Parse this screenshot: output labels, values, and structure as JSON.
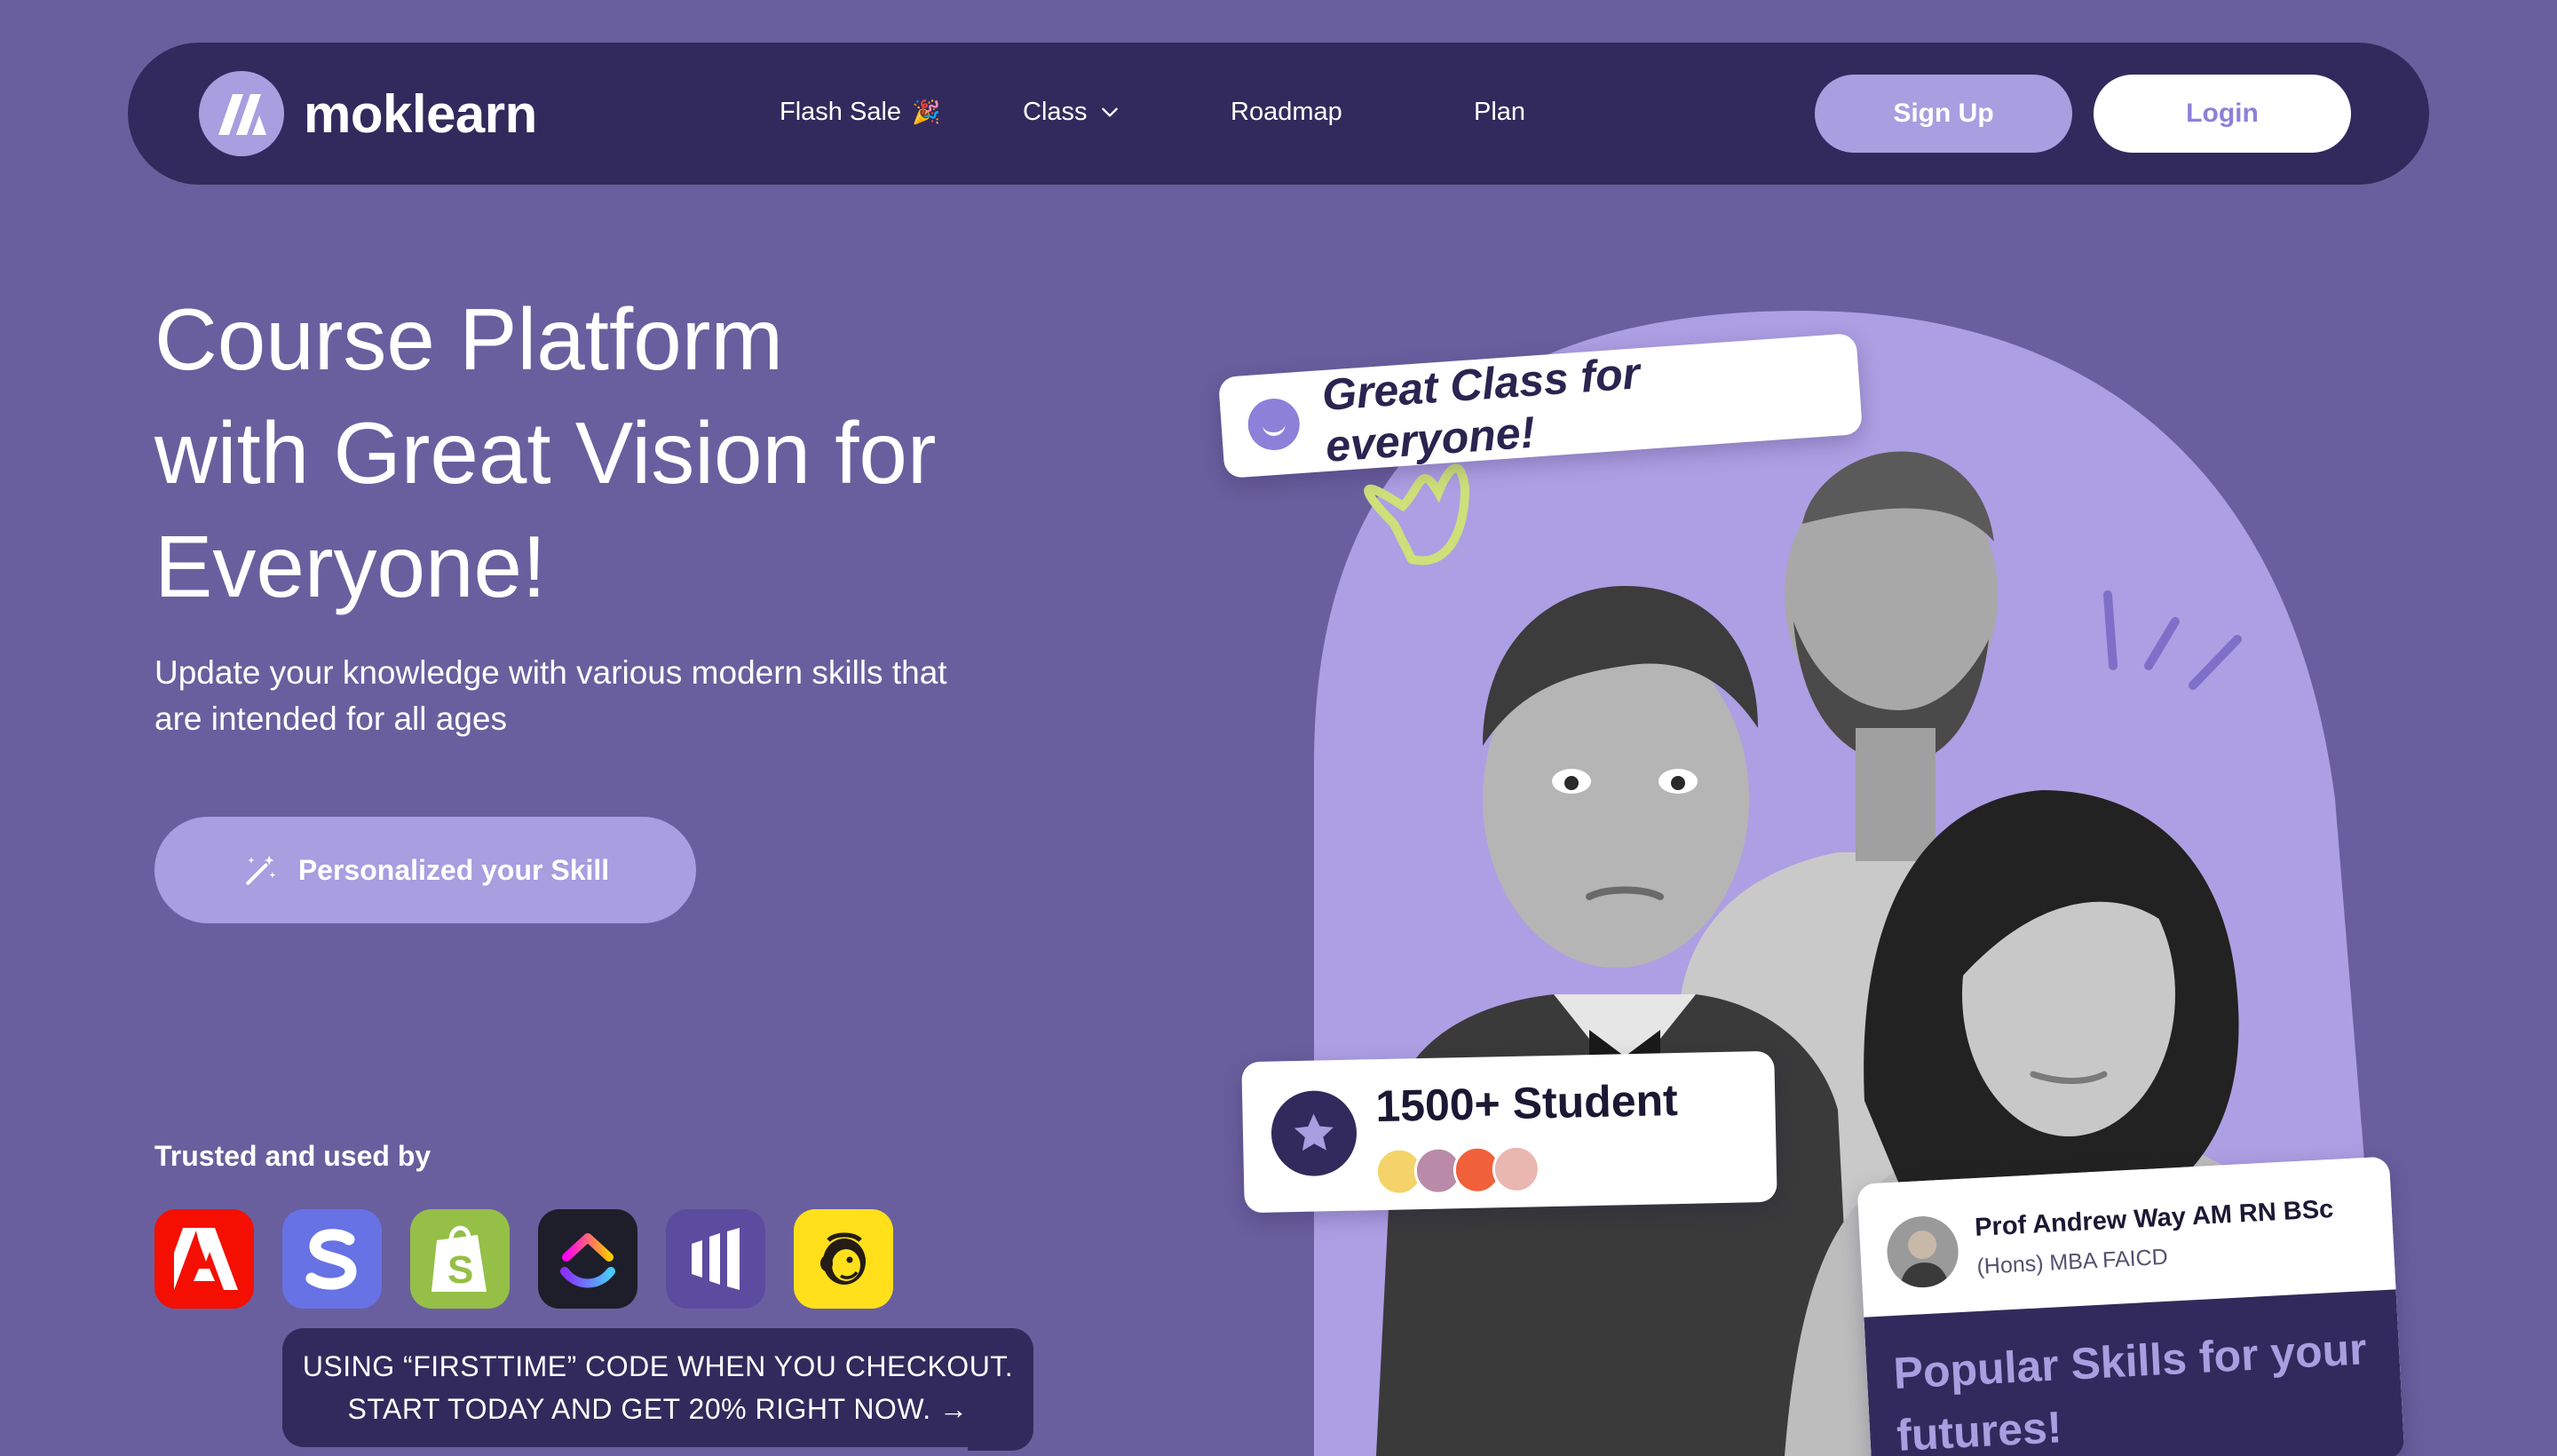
{
  "brand": {
    "name": "moklearn"
  },
  "nav": {
    "links": [
      {
        "label": "Flash Sale",
        "emoji": "🎉"
      },
      {
        "label": "Class"
      },
      {
        "label": "Roadmap"
      },
      {
        "label": "Plan"
      }
    ],
    "signup_label": "Sign Up",
    "login_label": "Login"
  },
  "hero": {
    "title_lines": [
      "Course Platform",
      "with Great Vision for",
      "Everyone!"
    ],
    "subtitle_lines": [
      "Update your knowledge with various modern skills that",
      "are intended for all ages"
    ],
    "cta_label": "Personalized your Skill"
  },
  "trusted": {
    "label": "Trusted and used by",
    "brands": [
      "adobe-icon",
      "stripe-icon",
      "shopify-icon",
      "clickup-icon",
      "marketo-icon",
      "mailchimp-icon"
    ]
  },
  "promo": {
    "line1": "USING “FIRSTTIME” CODE WHEN YOU CHECKOUT.",
    "line2": "START TODAY AND GET 20% RIGHT NOW. →"
  },
  "art": {
    "great_class": "Great Class for everyone!",
    "students": "1500+ Student",
    "prof_name": "Prof Andrew Way AM RN BSc",
    "prof_degree": "(Hons) MBA FAICD",
    "popular_line1": "Popular Skills for your",
    "popular_line2": "futures!"
  },
  "colors": {
    "background": "#6a5f9e",
    "nav": "#322a5c",
    "accent": "#a89ee0",
    "login_text": "#8c80d8"
  }
}
